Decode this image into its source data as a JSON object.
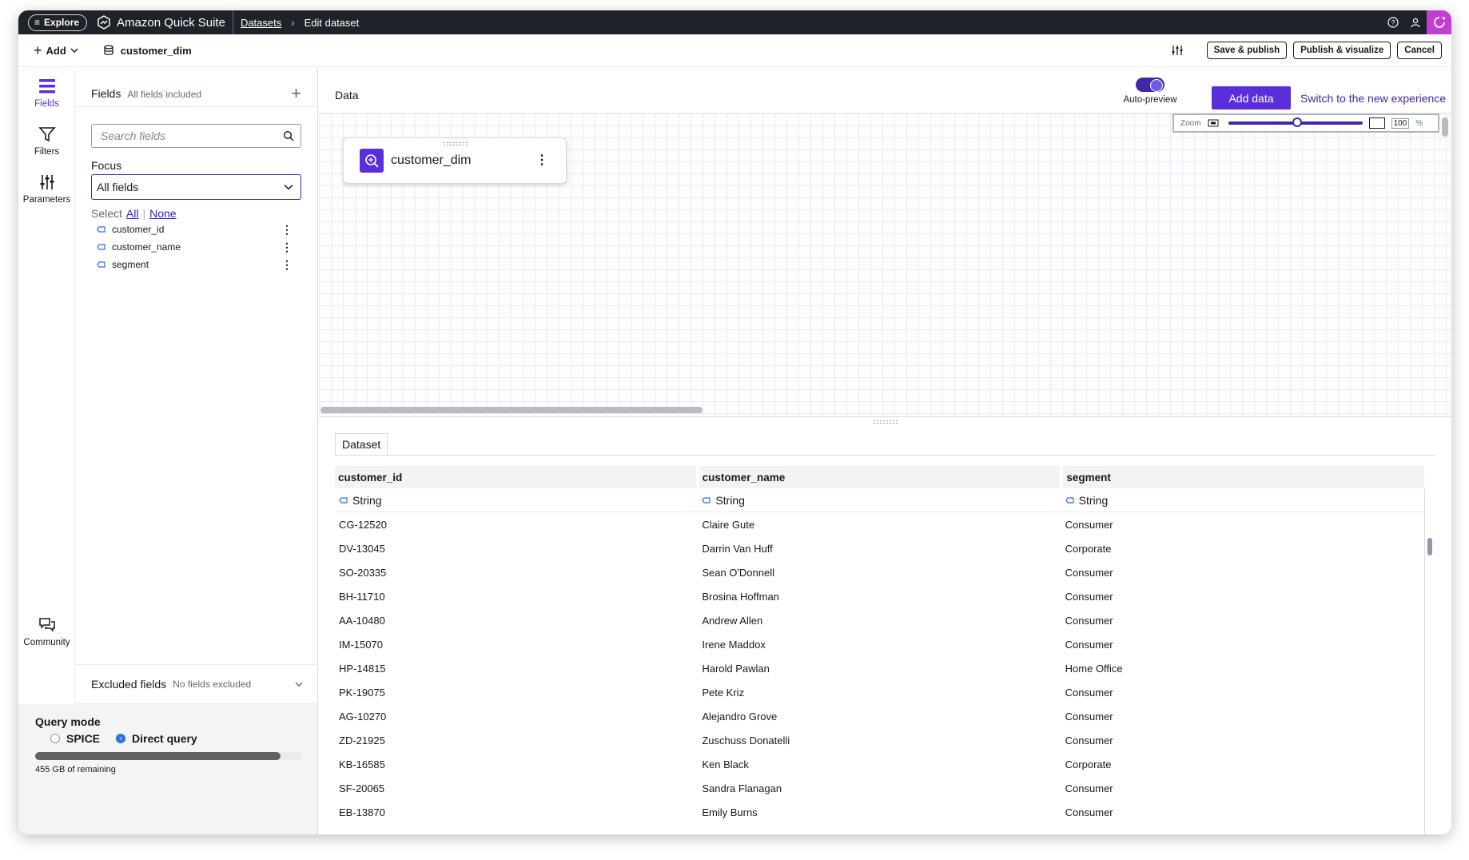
{
  "topbar": {
    "explore_label": "Explore",
    "brand": "Amazon Quick Suite",
    "breadcrumb_link": "Datasets",
    "breadcrumb_current": "Edit dataset"
  },
  "toolbar": {
    "add_label": "Add",
    "dataset_name": "customer_dim",
    "save_publish": "Save & publish",
    "publish_visualize": "Publish & visualize",
    "cancel": "Cancel"
  },
  "rail": {
    "fields": "Fields",
    "filters": "Filters",
    "parameters": "Parameters",
    "community": "Community"
  },
  "fields_panel": {
    "title": "Fields",
    "subtitle": "All fields included",
    "search_placeholder": "Search fields",
    "focus_label": "Focus",
    "focus_value": "All fields",
    "select_label": "Select",
    "select_all": "All",
    "select_none": "None",
    "fields": [
      "customer_id",
      "customer_name",
      "segment"
    ],
    "excluded_title": "Excluded fields",
    "excluded_sub": "No fields excluded"
  },
  "query_mode": {
    "title": "Query mode",
    "options": [
      "SPICE",
      "Direct query"
    ],
    "selected": "Direct query",
    "usage_fraction": 0.92,
    "remaining": "455 GB of remaining"
  },
  "data": {
    "title": "Data",
    "auto_preview": "Auto-preview",
    "add_data": "Add data",
    "switch_link": "Switch to the new experience",
    "zoom_label": "Zoom",
    "zoom_value": "100",
    "zoom_unit": "%",
    "node_name": "customer_dim"
  },
  "dataset": {
    "tab": "Dataset",
    "columns": [
      "customer_id",
      "customer_name",
      "segment"
    ],
    "types": [
      "String",
      "String",
      "String"
    ],
    "rows": [
      [
        "CG-12520",
        "Claire Gute",
        "Consumer"
      ],
      [
        "DV-13045",
        "Darrin Van Huff",
        "Corporate"
      ],
      [
        "SO-20335",
        "Sean O'Donnell",
        "Consumer"
      ],
      [
        "BH-11710",
        "Brosina Hoffman",
        "Consumer"
      ],
      [
        "AA-10480",
        "Andrew Allen",
        "Consumer"
      ],
      [
        "IM-15070",
        "Irene Maddox",
        "Consumer"
      ],
      [
        "HP-14815",
        "Harold Pawlan",
        "Home Office"
      ],
      [
        "PK-19075",
        "Pete Kriz",
        "Consumer"
      ],
      [
        "AG-10270",
        "Alejandro Grove",
        "Consumer"
      ],
      [
        "ZD-21925",
        "Zuschuss Donatelli",
        "Consumer"
      ],
      [
        "KB-16585",
        "Ken Black",
        "Corporate"
      ],
      [
        "SF-20065",
        "Sandra Flanagan",
        "Consumer"
      ],
      [
        "EB-13870",
        "Emily Burns",
        "Consumer"
      ]
    ]
  },
  "colors": {
    "accent": "#5a2fd9",
    "topbar": "#1f2229",
    "link": "#4226a8"
  }
}
